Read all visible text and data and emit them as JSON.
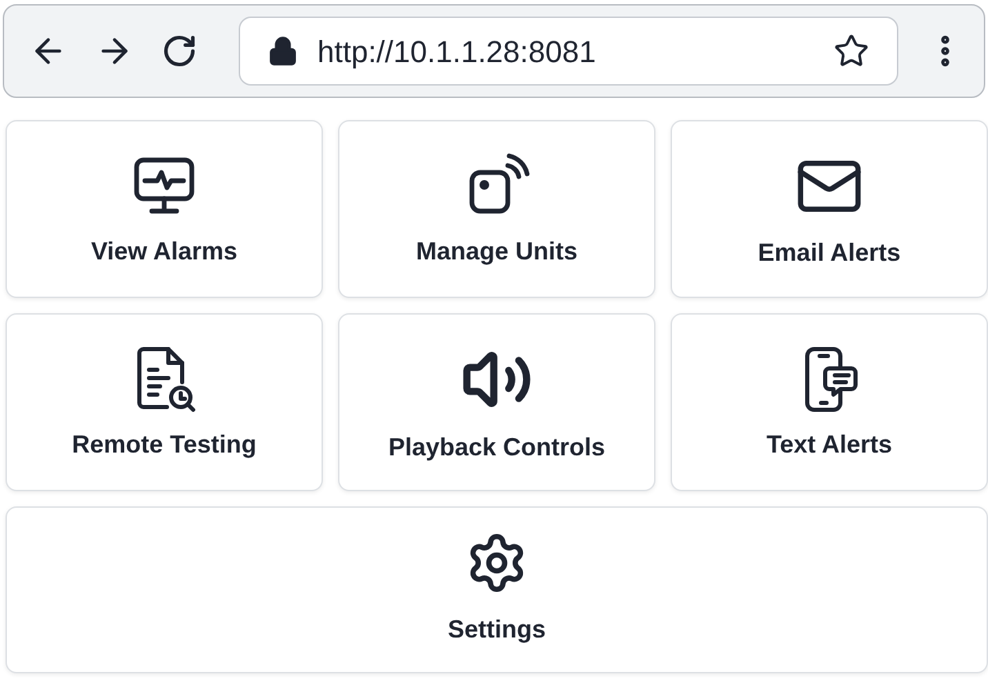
{
  "browser": {
    "url": "http://10.1.1.28:8081"
  },
  "tiles": [
    {
      "label": "View Alarms"
    },
    {
      "label": "Manage Units"
    },
    {
      "label": "Email Alerts"
    },
    {
      "label": "Remote Testing"
    },
    {
      "label": "Playback Controls"
    },
    {
      "label": "Text Alerts"
    }
  ],
  "settings": {
    "label": "Settings"
  }
}
